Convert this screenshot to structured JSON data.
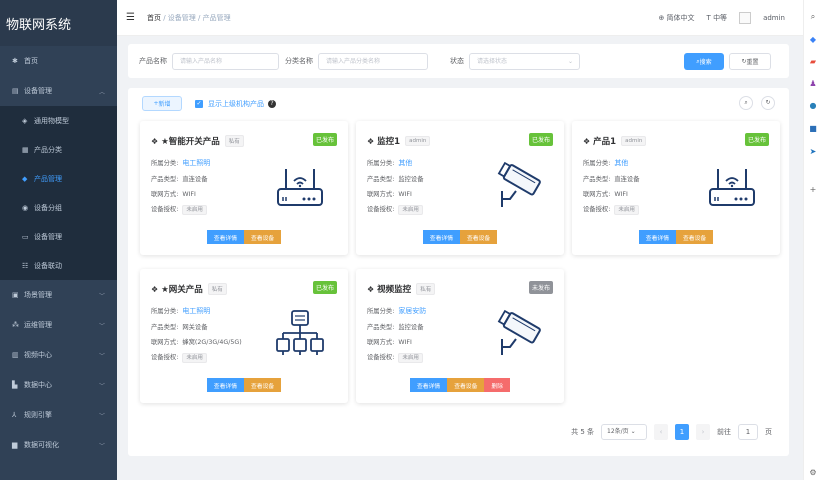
{
  "app": {
    "title": "物联网系统"
  },
  "sidebar": {
    "items": [
      {
        "label": "首页",
        "icon": "home-icon"
      },
      {
        "label": "设备管理",
        "icon": "device-icon",
        "open": true,
        "children": [
          {
            "label": "通用物模型"
          },
          {
            "label": "产品分类"
          },
          {
            "label": "产品管理",
            "active": true
          },
          {
            "label": "设备分组"
          },
          {
            "label": "设备管理"
          },
          {
            "label": "设备联动"
          }
        ]
      },
      {
        "label": "场景管理"
      },
      {
        "label": "运维管理"
      },
      {
        "label": "视频中心"
      },
      {
        "label": "数据中心"
      },
      {
        "label": "规则引擎"
      },
      {
        "label": "数据可视化"
      }
    ]
  },
  "header": {
    "breadcrumb": [
      "首页",
      "设备管理",
      "产品管理"
    ],
    "lang": "简体中文",
    "size": "中等",
    "user": "admin"
  },
  "search": {
    "product_name_label": "产品名称",
    "product_name_placeholder": "请输入产品名称",
    "category_label": "分类名称",
    "category_placeholder": "请输入产品分类名称",
    "status_label": "状态",
    "status_placeholder": "请选择状态",
    "search_btn": "搜索",
    "reset_btn": "重置"
  },
  "toolbar": {
    "add_btn": "新增",
    "show_parent": "显示上级机构产品"
  },
  "cards": [
    {
      "name": "★智能开关产品",
      "tag": "私有",
      "status": "已发布",
      "status_color": "#67c23a",
      "category_label": "所属分类:",
      "category": "电工照明",
      "type_label": "产品类型:",
      "type": "直连设备",
      "network_label": "联网方式:",
      "network": "WIFI",
      "auth_label": "设备授权:",
      "auth": "未启用",
      "buttons": [
        "查看详情",
        "查看设备"
      ],
      "illus": "router"
    },
    {
      "name": "监控1",
      "tag": "admin",
      "status": "已发布",
      "status_color": "#67c23a",
      "category_label": "所属分类:",
      "category": "其他",
      "type_label": "产品类型:",
      "type": "监控设备",
      "network_label": "联网方式:",
      "network": "WIFI",
      "auth_label": "设备授权:",
      "auth": "未启用",
      "buttons": [
        "查看详情",
        "查看设备"
      ],
      "illus": "camera"
    },
    {
      "name": "产品1",
      "tag": "admin",
      "status": "已发布",
      "status_color": "#67c23a",
      "category_label": "所属分类:",
      "category": "其他",
      "type_label": "产品类型:",
      "type": "直连设备",
      "network_label": "联网方式:",
      "network": "WIFI",
      "auth_label": "设备授权:",
      "auth": "未启用",
      "buttons": [
        "查看详情",
        "查看设备"
      ],
      "illus": "router"
    },
    {
      "name": "★网关产品",
      "tag": "私有",
      "status": "已发布",
      "status_color": "#67c23a",
      "category_label": "所属分类:",
      "category": "电工照明",
      "type_label": "产品类型:",
      "type": "网关设备",
      "network_label": "联网方式:",
      "network": "蜂窝(2G/3G/4G/5G)",
      "auth_label": "设备授权:",
      "auth": "未启用",
      "buttons": [
        "查看详情",
        "查看设备"
      ],
      "illus": "gateway"
    },
    {
      "name": "视频监控",
      "tag": "私有",
      "status": "未发布",
      "status_color": "#909399",
      "category_label": "所属分类:",
      "category": "家居安防",
      "type_label": "产品类型:",
      "type": "监控设备",
      "network_label": "联网方式:",
      "network": "WIFI",
      "auth_label": "设备授权:",
      "auth": "未启用",
      "buttons": [
        "查看详情",
        "查看设备",
        "删除"
      ],
      "illus": "camera"
    }
  ],
  "pagination": {
    "total": "共 5 条",
    "page_size": "12条/页",
    "current": "1",
    "goto_label": "前往",
    "goto_value": "1",
    "page_suffix": "页"
  }
}
